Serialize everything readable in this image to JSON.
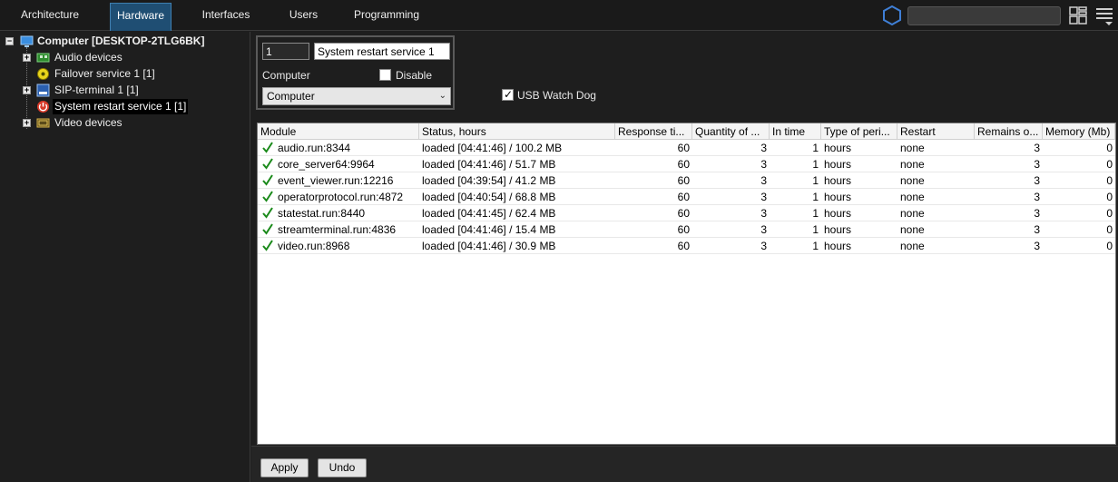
{
  "nav": {
    "tabs": [
      {
        "label": "Architecture"
      },
      {
        "label": "Hardware"
      },
      {
        "label": "Interfaces"
      },
      {
        "label": "Users"
      },
      {
        "label": "Programming"
      }
    ],
    "active_tab": "Hardware",
    "search_value": ""
  },
  "tree": {
    "root": {
      "label": "Computer [DESKTOP-2TLG6BK]"
    },
    "children": [
      {
        "label": "Audio devices",
        "icon": "audio-board-icon"
      },
      {
        "label": "Failover service 1 [1]",
        "icon": "failover-gear-icon"
      },
      {
        "label": "SIP-terminal 1 [1]",
        "icon": "sip-icon"
      },
      {
        "label": "System restart service 1 [1]",
        "icon": "power-icon"
      },
      {
        "label": "Video devices",
        "icon": "video-board-icon"
      }
    ]
  },
  "settings": {
    "id_value": "1",
    "name_value": "System restart service 1",
    "computer_label": "Computer",
    "disable_label": "Disable",
    "disable_checked": false,
    "computer_select_value": "Computer",
    "usb_watchdog_label": "USB Watch Dog",
    "usb_watchdog_checked": true
  },
  "table": {
    "columns": [
      "Module",
      "Status, hours",
      "Response ti...",
      "Quantity of ...",
      "In time",
      "Type of peri...",
      "Restart",
      "Remains o...",
      "Memory (Mb)"
    ],
    "rows": [
      [
        "audio.run:8344",
        "loaded [04:41:46] / 100.2 MB",
        "60",
        "3",
        "1",
        "hours",
        "none",
        "3",
        "0"
      ],
      [
        "core_server64:9964",
        "loaded [04:41:46] / 51.7 MB",
        "60",
        "3",
        "1",
        "hours",
        "none",
        "3",
        "0"
      ],
      [
        "event_viewer.run:12216",
        "loaded [04:39:54] / 41.2 MB",
        "60",
        "3",
        "1",
        "hours",
        "none",
        "3",
        "0"
      ],
      [
        "operatorprotocol.run:4872",
        "loaded [04:40:54] / 68.8 MB",
        "60",
        "3",
        "1",
        "hours",
        "none",
        "3",
        "0"
      ],
      [
        "statestat.run:8440",
        "loaded [04:41:45] / 62.4 MB",
        "60",
        "3",
        "1",
        "hours",
        "none",
        "3",
        "0"
      ],
      [
        "streamterminal.run:4836",
        "loaded [04:41:46] / 15.4 MB",
        "60",
        "3",
        "1",
        "hours",
        "none",
        "3",
        "0"
      ],
      [
        "video.run:8968",
        "loaded [04:41:46] / 30.9 MB",
        "60",
        "3",
        "1",
        "hours",
        "none",
        "3",
        "0"
      ]
    ]
  },
  "buttons": {
    "apply_label": "Apply",
    "undo_label": "Undo"
  },
  "colors": {
    "active_tab_bg": "#1f4e73",
    "check_green": "#1a8a1a",
    "hex_blue": "#3f7fd6"
  }
}
